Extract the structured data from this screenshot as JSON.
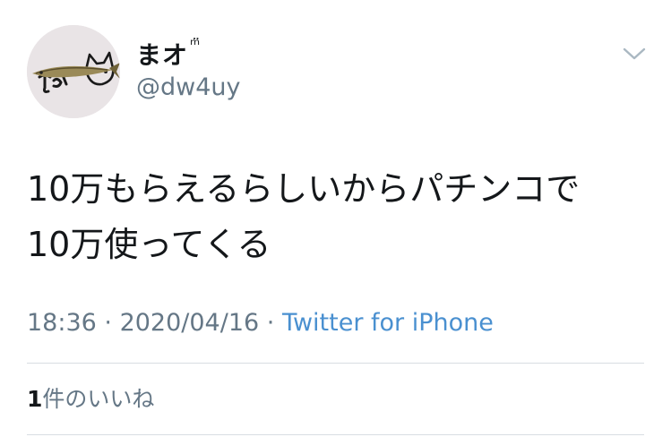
{
  "user": {
    "display_name": "まオ",
    "name_emoji": "ᵐ̈",
    "handle": "@dw4uy"
  },
  "tweet": {
    "text_line1": "10万もらえるらしいからパチンコで",
    "text_line2": "10万使ってくる",
    "time": "18:36",
    "date": "2020/04/16",
    "separator": " · ",
    "source": "Twitter for iPhone"
  },
  "engagement": {
    "like_count": "1",
    "like_label": "件のいいね"
  },
  "icons": {
    "menu": "chevron-down-icon",
    "avatar": "fish-cat-avatar"
  },
  "colors": {
    "text": "#14171a",
    "secondary": "#657786",
    "link": "#4a90d0",
    "divider": "#d8dde2"
  }
}
